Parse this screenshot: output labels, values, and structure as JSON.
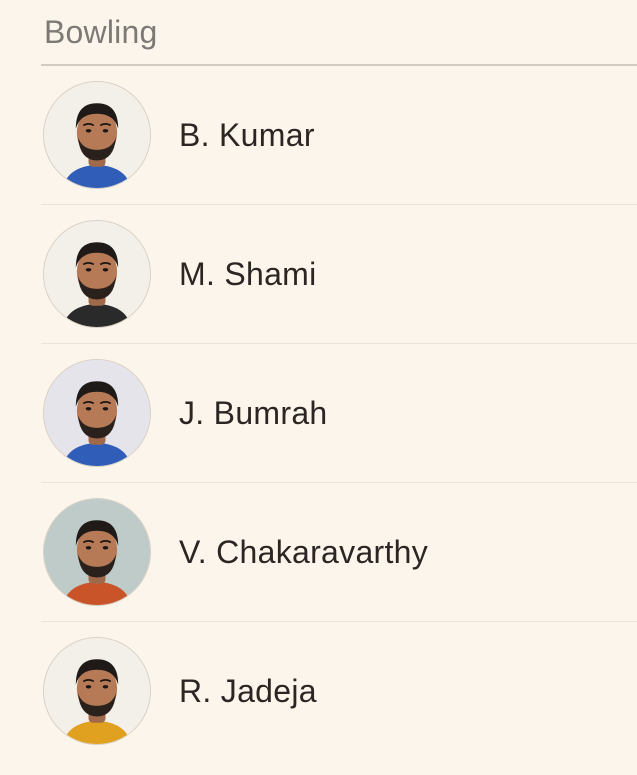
{
  "section": {
    "title": "Bowling"
  },
  "players": [
    {
      "name": "B. Kumar",
      "icon": "player-avatar-icon",
      "jersey": "#2f5db8",
      "bg": "#f3efe9"
    },
    {
      "name": "M. Shami",
      "icon": "player-avatar-icon",
      "jersey": "#2a2a2a",
      "bg": "#f3efe9"
    },
    {
      "name": "J. Bumrah",
      "icon": "player-avatar-icon",
      "jersey": "#2f5db8",
      "bg": "#e4e4ea"
    },
    {
      "name": "V. Chakaravarthy",
      "icon": "player-avatar-icon",
      "jersey": "#c9542a",
      "bg": "#bfcbc9"
    },
    {
      "name": "R. Jadeja",
      "icon": "player-avatar-icon",
      "jersey": "#e0a020",
      "bg": "#f3efe9"
    }
  ],
  "colors": {
    "background": "#fcf5ec",
    "title": "#7d7a76",
    "text": "#2b2623",
    "divider": "#ece4d9"
  }
}
